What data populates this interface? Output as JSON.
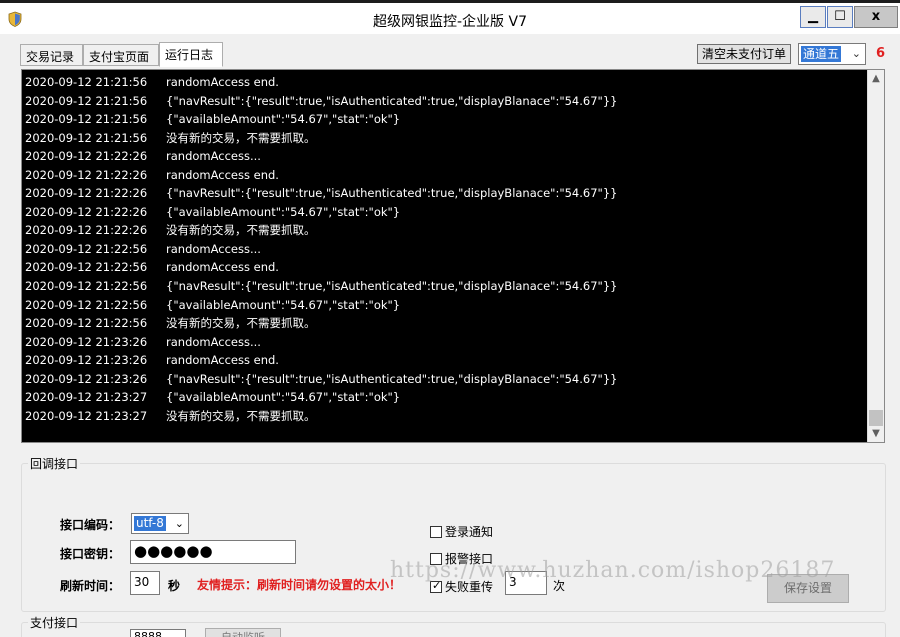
{
  "window": {
    "title": "超级网银监控-企业版 V7",
    "min_label": "▁",
    "max_label": "☐",
    "close_label": "x"
  },
  "tabs": [
    {
      "label": "交易记录"
    },
    {
      "label": "支付宝页面"
    },
    {
      "label": "运行日志"
    }
  ],
  "toolbar": {
    "clear_unpaid_label": "清空未支付订单",
    "channel_value": "通道五",
    "count_value": "6"
  },
  "log": [
    {
      "time": "2020-09-12 21:21:56",
      "message": "randomAccess end."
    },
    {
      "time": "2020-09-12 21:21:56",
      "message": "{\"navResult\":{\"result\":true,\"isAuthenticated\":true,\"displayBlanace\":\"54.67\"}}"
    },
    {
      "time": "2020-09-12 21:21:56",
      "message": "{\"availableAmount\":\"54.67\",\"stat\":\"ok\"}"
    },
    {
      "time": "2020-09-12 21:21:56",
      "message": "没有新的交易，不需要抓取。"
    },
    {
      "time": "2020-09-12 21:22:26",
      "message": "randomAccess..."
    },
    {
      "time": "2020-09-12 21:22:26",
      "message": "randomAccess end."
    },
    {
      "time": "2020-09-12 21:22:26",
      "message": "{\"navResult\":{\"result\":true,\"isAuthenticated\":true,\"displayBlanace\":\"54.67\"}}"
    },
    {
      "time": "2020-09-12 21:22:26",
      "message": "{\"availableAmount\":\"54.67\",\"stat\":\"ok\"}"
    },
    {
      "time": "2020-09-12 21:22:26",
      "message": "没有新的交易，不需要抓取。"
    },
    {
      "time": "2020-09-12 21:22:56",
      "message": "randomAccess..."
    },
    {
      "time": "2020-09-12 21:22:56",
      "message": "randomAccess end."
    },
    {
      "time": "2020-09-12 21:22:56",
      "message": "{\"navResult\":{\"result\":true,\"isAuthenticated\":true,\"displayBlanace\":\"54.67\"}}"
    },
    {
      "time": "2020-09-12 21:22:56",
      "message": "{\"availableAmount\":\"54.67\",\"stat\":\"ok\"}"
    },
    {
      "time": "2020-09-12 21:22:56",
      "message": "没有新的交易，不需要抓取。"
    },
    {
      "time": "2020-09-12 21:23:26",
      "message": "randomAccess..."
    },
    {
      "time": "2020-09-12 21:23:26",
      "message": "randomAccess end."
    },
    {
      "time": "2020-09-12 21:23:26",
      "message": "{\"navResult\":{\"result\":true,\"isAuthenticated\":true,\"displayBlanace\":\"54.67\"}}"
    },
    {
      "time": "2020-09-12 21:23:27",
      "message": "{\"availableAmount\":\"54.67\",\"stat\":\"ok\"}"
    },
    {
      "time": "2020-09-12 21:23:27",
      "message": "没有新的交易，不需要抓取。"
    }
  ],
  "callback": {
    "group_title": "回调接口",
    "encoding_label": "接口编码：",
    "encoding_value": "utf-8",
    "secret_label": "接口密钥：",
    "secret_value": "●●●●●●",
    "refresh_label": "刷新时间：",
    "refresh_value": "30",
    "refresh_unit": "秒",
    "tip": "友情提示：刷新时间请勿设置的太小！",
    "login_notify_label": "登录通知",
    "alarm_label": "报警接口",
    "retry_label": "失败重传",
    "retry_value": "3",
    "retry_unit": "次",
    "save_label": "保存设置"
  },
  "payment": {
    "group_title": "支付接口",
    "input_value": "8888",
    "button_label": "自动监听"
  },
  "watermark": "https://www.huzhan.com/ishop26187",
  "colors": {
    "log_bg": "#000000",
    "log_text": "#ffffff",
    "alert_red": "#e02020",
    "select_blue": "#3478d6"
  }
}
